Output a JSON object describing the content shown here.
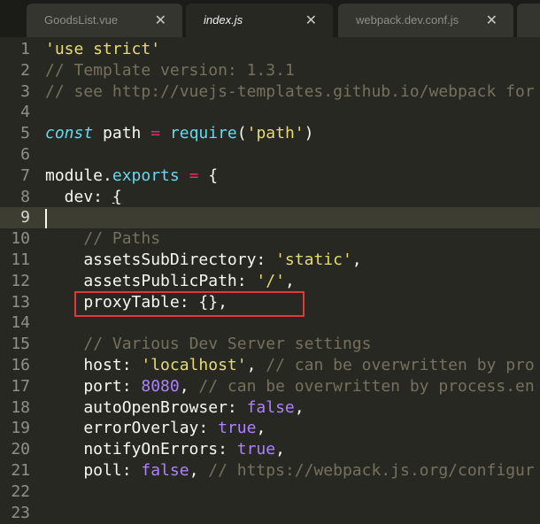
{
  "tabs": [
    {
      "label": "GoodsList.vue",
      "close": "✕"
    },
    {
      "label": "index.js",
      "close": "✕"
    },
    {
      "label": "webpack.dev.conf.js",
      "close": "✕"
    },
    {
      "label": "",
      "close": ""
    }
  ],
  "lines": [
    {
      "n": "1",
      "segs": [
        {
          "t": "'use strict'",
          "c": "str"
        }
      ]
    },
    {
      "n": "2",
      "segs": [
        {
          "t": "// Template version: 1.3.1",
          "c": "cmt"
        }
      ]
    },
    {
      "n": "3",
      "segs": [
        {
          "t": "// see http://vuejs-templates.github.io/webpack for",
          "c": "cmt"
        }
      ]
    },
    {
      "n": "4",
      "segs": []
    },
    {
      "n": "5",
      "segs": [
        {
          "t": "const",
          "c": "kw"
        },
        {
          "t": " path ",
          "c": ""
        },
        {
          "t": "=",
          "c": "op"
        },
        {
          "t": " ",
          "c": ""
        },
        {
          "t": "require",
          "c": "fn"
        },
        {
          "t": "(",
          "c": ""
        },
        {
          "t": "'path'",
          "c": "str"
        },
        {
          "t": ")",
          "c": ""
        }
      ]
    },
    {
      "n": "6",
      "segs": []
    },
    {
      "n": "7",
      "segs": [
        {
          "t": "module",
          "c": ""
        },
        {
          "t": ".",
          "c": ""
        },
        {
          "t": "exports",
          "c": "fn"
        },
        {
          "t": " ",
          "c": ""
        },
        {
          "t": "=",
          "c": "op"
        },
        {
          "t": " {",
          "c": ""
        }
      ]
    },
    {
      "n": "8",
      "segs": [
        {
          "t": "  dev: ",
          "c": ""
        },
        {
          "t": "{",
          "c": "ul"
        }
      ]
    },
    {
      "n": "9",
      "segs": [],
      "current": true
    },
    {
      "n": "10",
      "segs": [
        {
          "t": "    ",
          "c": ""
        },
        {
          "t": "// Paths",
          "c": "cmt"
        }
      ]
    },
    {
      "n": "11",
      "segs": [
        {
          "t": "    assetsSubDirectory: ",
          "c": ""
        },
        {
          "t": "'static'",
          "c": "str"
        },
        {
          "t": ",",
          "c": ""
        }
      ]
    },
    {
      "n": "12",
      "segs": [
        {
          "t": "    assetsPublicPath: ",
          "c": ""
        },
        {
          "t": "'/'",
          "c": "str"
        },
        {
          "t": ",",
          "c": ""
        }
      ]
    },
    {
      "n": "13",
      "segs": [
        {
          "t": "    proxyTable: {},",
          "c": ""
        }
      ]
    },
    {
      "n": "14",
      "segs": []
    },
    {
      "n": "15",
      "segs": [
        {
          "t": "    ",
          "c": ""
        },
        {
          "t": "// Various Dev Server settings",
          "c": "cmt"
        }
      ]
    },
    {
      "n": "16",
      "segs": [
        {
          "t": "    host: ",
          "c": ""
        },
        {
          "t": "'localhost'",
          "c": "str"
        },
        {
          "t": ", ",
          "c": ""
        },
        {
          "t": "// can be overwritten by pro",
          "c": "cmt"
        }
      ]
    },
    {
      "n": "17",
      "segs": [
        {
          "t": "    port: ",
          "c": ""
        },
        {
          "t": "8080",
          "c": "num"
        },
        {
          "t": ", ",
          "c": ""
        },
        {
          "t": "// can be overwritten by process.en",
          "c": "cmt"
        }
      ]
    },
    {
      "n": "18",
      "segs": [
        {
          "t": "    autoOpenBrowser: ",
          "c": ""
        },
        {
          "t": "false",
          "c": "bool"
        },
        {
          "t": ",",
          "c": ""
        }
      ]
    },
    {
      "n": "19",
      "segs": [
        {
          "t": "    errorOverlay: ",
          "c": ""
        },
        {
          "t": "true",
          "c": "bool"
        },
        {
          "t": ",",
          "c": ""
        }
      ]
    },
    {
      "n": "20",
      "segs": [
        {
          "t": "    notifyOnErrors: ",
          "c": ""
        },
        {
          "t": "true",
          "c": "bool"
        },
        {
          "t": ",",
          "c": ""
        }
      ]
    },
    {
      "n": "21",
      "segs": [
        {
          "t": "    poll: ",
          "c": ""
        },
        {
          "t": "false",
          "c": "bool"
        },
        {
          "t": ", ",
          "c": ""
        },
        {
          "t": "// https://webpack.js.org/configur",
          "c": "cmt"
        }
      ]
    },
    {
      "n": "22",
      "segs": []
    },
    {
      "n": "23",
      "segs": []
    }
  ],
  "colors": {
    "background": "#272822",
    "string": "#e6db74",
    "comment": "#75715e",
    "keyword": "#66d9ef",
    "operator": "#f92672",
    "number": "#ae81ff",
    "highlight_box": "#e0383b"
  }
}
